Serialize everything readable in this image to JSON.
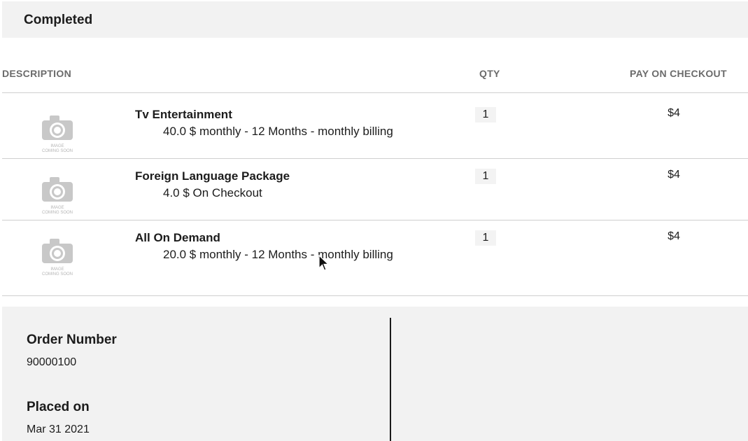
{
  "status": {
    "title": "Completed"
  },
  "table": {
    "headers": {
      "description": "DESCRIPTION",
      "qty": "QTY",
      "pay_on_checkout": "PAY ON CHECKOUT"
    },
    "placeholder_image": {
      "icon": "camera-icon",
      "line1": "IMAGE",
      "line2": "COMING SOON"
    },
    "rows": [
      {
        "name": "Tv Entertainment",
        "detail": "40.0 $ monthly - 12 Months - monthly billing",
        "qty": "1",
        "price": "$4"
      },
      {
        "name": "Foreign Language Package",
        "detail": "4.0 $ On Checkout",
        "qty": "1",
        "price": "$4"
      },
      {
        "name": "All On Demand",
        "detail": "20.0 $ monthly - 12 Months - monthly billing",
        "qty": "1",
        "price": "$4"
      }
    ]
  },
  "summary": {
    "order_number_label": "Order Number",
    "order_number_value": "90000100",
    "placed_on_label": "Placed on",
    "placed_on_value": "Mar 31 2021"
  },
  "colors": {
    "panel_bg": "#f2f2f2",
    "header_text": "#6b6b6b",
    "divider": "#cfcfcf",
    "text": "#1c1c1c"
  }
}
